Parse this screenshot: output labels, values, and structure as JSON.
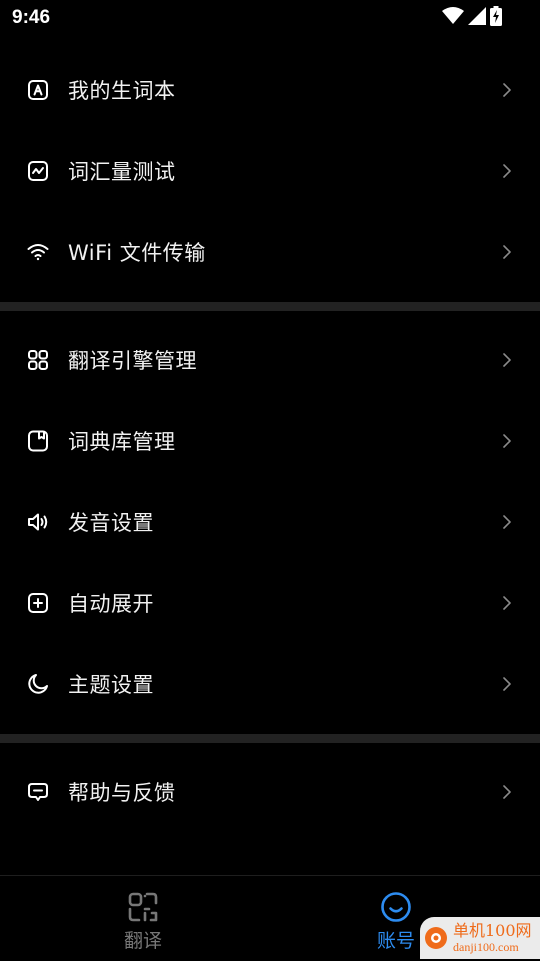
{
  "status_bar": {
    "time": "9:46",
    "icons": [
      "wifi-icon",
      "signal-icon",
      "battery-charging-icon"
    ]
  },
  "colors": {
    "background": "#000000",
    "divider": "#222222",
    "text": "#f2f2f2",
    "chevron": "#8a8a8a",
    "accent": "#2d8cf0",
    "inactive": "#777777"
  },
  "menu": {
    "groups": [
      {
        "items": [
          {
            "icon": "letter-a-box-icon",
            "label": "我的生词本"
          },
          {
            "icon": "trend-chart-icon",
            "label": "词汇量测试"
          },
          {
            "icon": "wifi-icon",
            "label": "WiFi 文件传输"
          }
        ]
      },
      {
        "items": [
          {
            "icon": "grid-icon",
            "label": "翻译引擎管理"
          },
          {
            "icon": "bookmark-icon",
            "label": "词典库管理"
          },
          {
            "icon": "speaker-icon",
            "label": "发音设置"
          },
          {
            "icon": "plus-box-icon",
            "label": "自动展开"
          },
          {
            "icon": "moon-icon",
            "label": "主题设置"
          }
        ]
      },
      {
        "items": [
          {
            "icon": "feedback-icon",
            "label": "帮助与反馈"
          }
        ]
      }
    ]
  },
  "bottom_nav": {
    "tabs": [
      {
        "icon": "scan-icon",
        "label": "翻译",
        "active": false
      },
      {
        "icon": "smile-face-icon",
        "label": "账号",
        "active": true
      }
    ]
  },
  "watermark": {
    "title": "单机100网",
    "subtitle": "danji100.com"
  }
}
